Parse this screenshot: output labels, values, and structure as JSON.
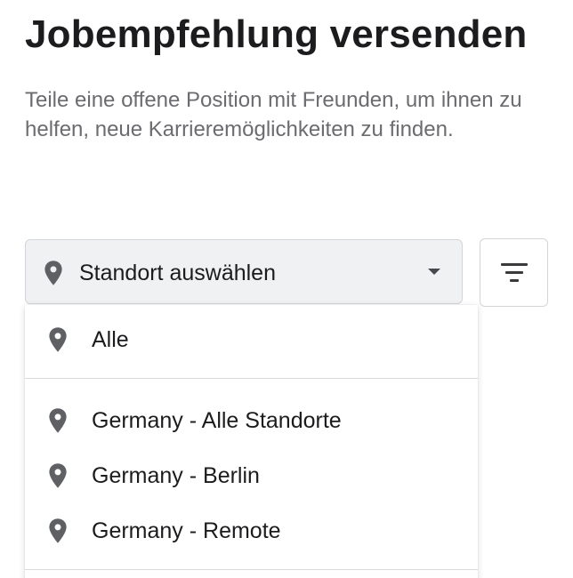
{
  "header": {
    "title": "Jobempfehlung versenden",
    "subtitle": "Teile eine offene Position mit Freunden, um ihnen zu helfen, neue Karrieremöglichkeiten zu finden."
  },
  "location_select": {
    "placeholder": "Standort auswählen",
    "icon": "location-pin-icon"
  },
  "filter_button": {
    "icon": "filter-icon"
  },
  "dropdown": {
    "options": [
      {
        "label": "Alle",
        "icon": "location-pin-icon"
      },
      {
        "label": "Germany - Alle Standorte",
        "icon": "location-pin-icon"
      },
      {
        "label": "Germany - Berlin",
        "icon": "location-pin-icon"
      },
      {
        "label": "Germany - Remote",
        "icon": "location-pin-icon"
      }
    ]
  },
  "colors": {
    "icon": "#5f6063",
    "select_background": "#f0f1f3",
    "border": "#d3d5d9"
  }
}
